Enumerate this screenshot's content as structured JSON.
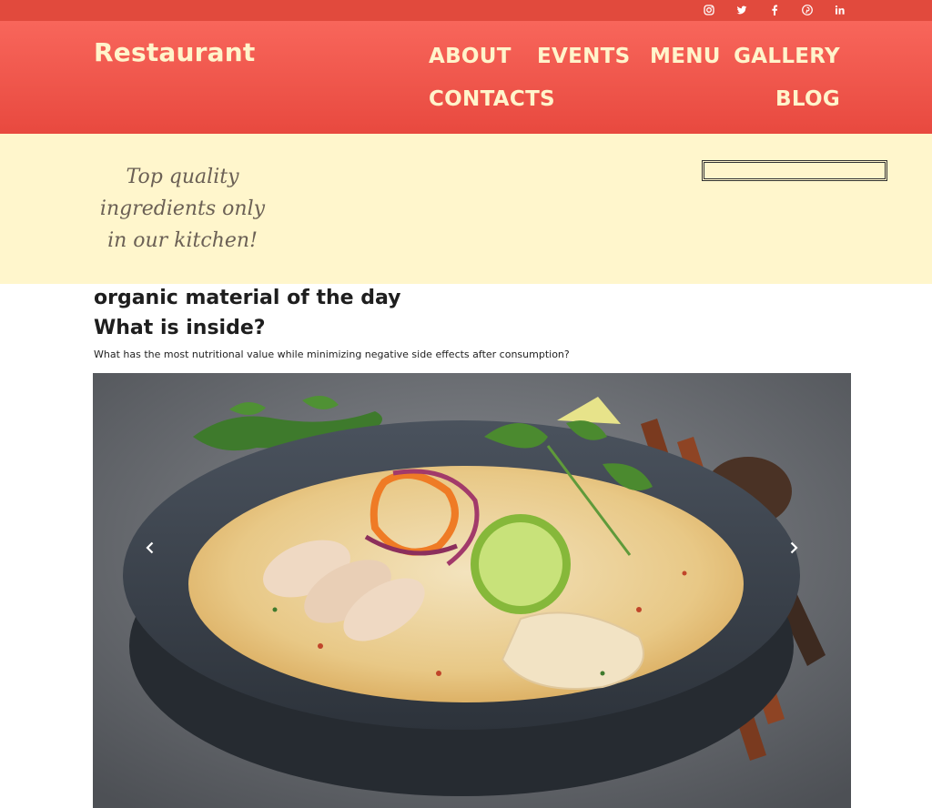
{
  "social": {
    "icons": [
      "instagram-icon",
      "twitter-icon",
      "facebook-icon",
      "pinterest-icon",
      "linkedin-icon"
    ]
  },
  "header": {
    "brand": "Restaurant",
    "nav": {
      "about": "ABOUT",
      "events": "EVENTS",
      "menu": "MENU",
      "gallery": "GALLERY",
      "contacts": "CONTACTS",
      "blog": "BLOG"
    }
  },
  "band": {
    "tagline": "Top quality ingredients only in our kitchen!",
    "search_value": ""
  },
  "content": {
    "title1": "organic material of the day",
    "title2": "What is inside?",
    "description": "What has the most nutritional value while minimizing negative side effects after consumption?"
  },
  "carousel": {
    "prev_icon": "chevron-left-icon",
    "next_icon": "chevron-right-icon"
  },
  "colors": {
    "topbar": "#e14a3d",
    "header_top": "#f8665b",
    "header_bottom": "#e8493f",
    "nav_text": "#fff4cb",
    "band": "#fff6cc"
  }
}
